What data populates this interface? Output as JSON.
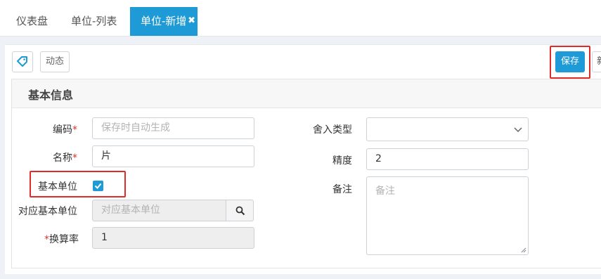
{
  "tabs": [
    {
      "label": "仪表盘"
    },
    {
      "label": "单位-列表"
    },
    {
      "label": "单位-新增",
      "close": "✖"
    }
  ],
  "toolbar": {
    "dynamic_label": "动态",
    "save_label": "保存",
    "new_label": "新"
  },
  "section": {
    "title": "基本信息"
  },
  "form": {
    "code": {
      "label": "编码",
      "required": "*",
      "placeholder": "保存时自动生成"
    },
    "name": {
      "label": "名称",
      "required": "*",
      "value": "片"
    },
    "base_unit": {
      "label": "基本单位",
      "checked": true
    },
    "ref_base_unit": {
      "label": "对应基本单位",
      "placeholder": "对应基本单位"
    },
    "rate": {
      "label": "换算率",
      "required": "*",
      "value": "1"
    },
    "rounding_type": {
      "label": "舍入类型",
      "value": ""
    },
    "precision": {
      "label": "精度",
      "value": "2"
    },
    "remark": {
      "label": "备注",
      "placeholder": "备注"
    }
  },
  "colors": {
    "accent": "#1e9ad6",
    "highlight": "#e02b2b",
    "required": "#d9362b"
  }
}
